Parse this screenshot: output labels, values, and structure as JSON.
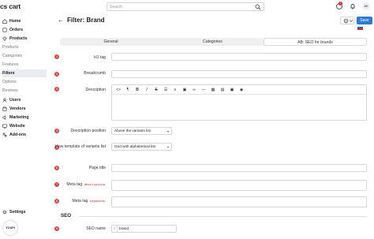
{
  "app": {
    "logo_text": "cs cart",
    "avatar_initials": "AE",
    "notification_count": "1"
  },
  "search": {
    "placeholder": "Search"
  },
  "header": {
    "back_arrow": "←",
    "title": "Filter: Brand",
    "save_label": "Save",
    "gear_icon": "gear-icon"
  },
  "sidebar": {
    "items": [
      {
        "label": "Home",
        "icon": "home-icon",
        "level": "top"
      },
      {
        "label": "Orders",
        "icon": "orders-icon",
        "level": "top"
      },
      {
        "label": "Products",
        "icon": "products-icon",
        "level": "top"
      },
      {
        "label": "Products",
        "level": "sub"
      },
      {
        "label": "Categories",
        "level": "sub"
      },
      {
        "label": "Features",
        "level": "sub"
      },
      {
        "label": "Filters",
        "level": "sub-active"
      },
      {
        "label": "Options",
        "level": "sub"
      },
      {
        "label": "Reviews",
        "level": "sub"
      },
      {
        "label": "Users",
        "icon": "users-icon",
        "level": "top"
      },
      {
        "label": "Vendors",
        "icon": "vendors-icon",
        "level": "top"
      },
      {
        "label": "Marketing",
        "icon": "marketing-icon",
        "level": "top"
      },
      {
        "label": "Website",
        "icon": "website-icon",
        "level": "top"
      },
      {
        "label": "Add-ons",
        "icon": "addons-icon",
        "level": "top"
      }
    ],
    "settings_label": "Settings",
    "bottom_badge": "YOUPI"
  },
  "tabs": [
    {
      "label": "General",
      "active": false
    },
    {
      "label": "Categories",
      "active": false
    },
    {
      "label": "AB: SEO for brands",
      "active": true
    }
  ],
  "form": {
    "rows": [
      {
        "num": "1",
        "label": "H1 tag"
      },
      {
        "num": "2",
        "label": "Breadcrumb"
      },
      {
        "num": "3",
        "label": "Description"
      },
      {
        "num": "4",
        "label": "Description position",
        "value": "Above the variants list"
      },
      {
        "num": "5",
        "label": "View template of variants list",
        "value": "Grid with alphabetical list"
      },
      {
        "num": "6",
        "label": "Page title"
      },
      {
        "num": "7",
        "label": "Meta tag",
        "code": "description"
      },
      {
        "num": "8",
        "label": "Meta tag",
        "code": "keywords"
      },
      {
        "num": "9",
        "label": "SEO name",
        "value": "brand",
        "prefix": "/"
      }
    ],
    "seo_section": "SEO"
  },
  "colors": {
    "accent": "#2a7bd6",
    "number_badge": "#e04545"
  }
}
